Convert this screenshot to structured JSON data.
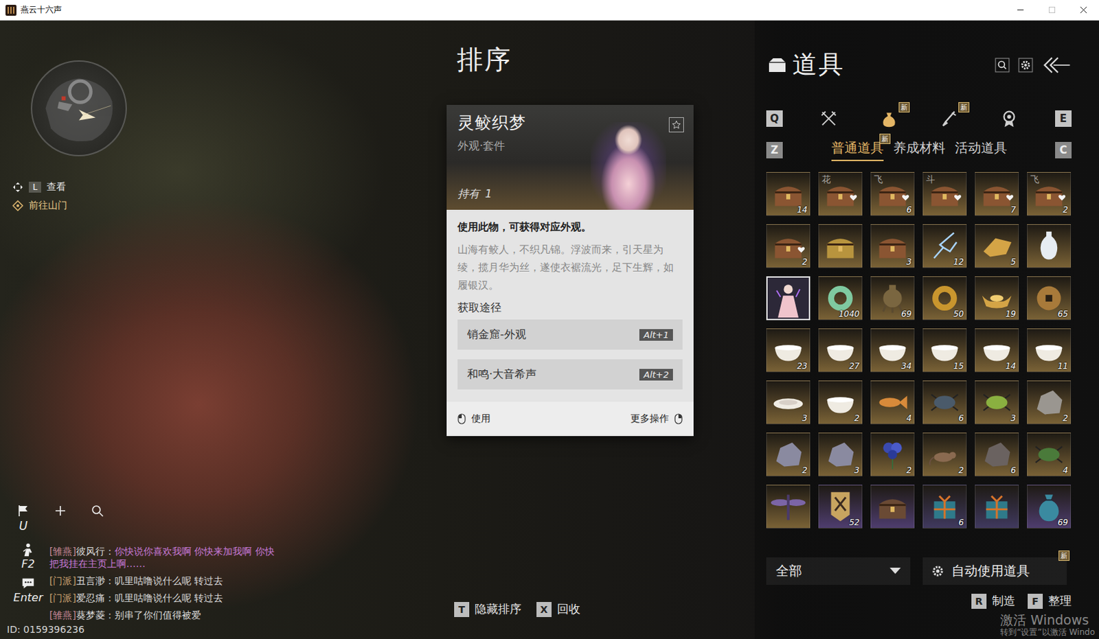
{
  "window": {
    "title": "燕云十六声"
  },
  "hud": {
    "view_hint": {
      "key": "L",
      "label": "查看"
    },
    "quest_hint": {
      "label": "前往山门"
    },
    "quick_buttons": [
      {
        "kind": "flag",
        "key": "U"
      },
      {
        "kind": "plus",
        "key": ""
      },
      {
        "kind": "search",
        "key": ""
      }
    ],
    "chat_buttons": [
      {
        "kind": "figure",
        "key": "F2"
      },
      {
        "kind": "chat",
        "key": "Enter"
      }
    ],
    "player_id": "ID: 0159396236"
  },
  "chat": [
    {
      "channel": "[雏燕]",
      "name": "彼风行：",
      "text": "你快说你喜欢我啊 你快来加我啊 你快把我挂在主页上啊……",
      "color": "#c77ad8",
      "channel_color": "#c98a9a"
    },
    {
      "channel": "[门派]",
      "name": "丑言渺：",
      "text": "叽里咕噜说什么呢 转过去",
      "color": "#dcdcdc",
      "channel_color": "#c8a070"
    },
    {
      "channel": "[门派]",
      "name": "爱忍痛：",
      "text": "叽里咕噜说什么呢 转过去",
      "color": "#dcdcdc",
      "channel_color": "#c8a070"
    },
    {
      "channel": "[雏燕]",
      "name": "葵梦菱：",
      "text": "别串了你们值得被爱",
      "color": "#dcdcdc",
      "channel_color": "#c98a9a"
    }
  ],
  "sort": {
    "title": "排序",
    "actions": [
      {
        "key": "T",
        "label": "隐藏排序"
      },
      {
        "key": "X",
        "label": "回收"
      }
    ]
  },
  "tooltip": {
    "name": "灵鲛织梦",
    "type": "外观·套件",
    "favorited": false,
    "held": {
      "label": "持有",
      "value": "1"
    },
    "description": "使用此物，可获得对应外观。",
    "lore": "山海有鲛人，不织凡锦。浮波而来，引天星为绫，揽月华为丝，遂使衣裾流光，足下生辉，如履银汉。",
    "sources_title": "获取途径",
    "sources": [
      {
        "label": "销金窟-外观",
        "key": "Alt+1"
      },
      {
        "label": "和鸣·大音希声",
        "key": "Alt+2"
      }
    ],
    "actions": [
      {
        "label": "使用",
        "button": "left"
      },
      {
        "label": "更多操作",
        "button": "right"
      }
    ]
  },
  "panel": {
    "title": "道具",
    "tab_keys": {
      "prev": "Q",
      "next": "E"
    },
    "tabs": [
      {
        "kind": "weapon",
        "selected": false,
        "badge": ""
      },
      {
        "kind": "bag",
        "selected": true,
        "badge": "新"
      },
      {
        "kind": "brush",
        "selected": false,
        "badge": "新"
      },
      {
        "kind": "medal",
        "selected": false,
        "badge": ""
      }
    ],
    "subtab_keys": {
      "prev": "Z",
      "next": "C"
    },
    "subtabs": [
      {
        "label": "普通道具",
        "selected": true,
        "badge": "新"
      },
      {
        "label": "养成材料",
        "selected": false,
        "badge": ""
      },
      {
        "label": "活动道具",
        "selected": false,
        "badge": ""
      }
    ],
    "items": [
      {
        "kind": "chest",
        "count": "14",
        "mark": "",
        "liked": false,
        "color": "#7a6236",
        "selected": false
      },
      {
        "kind": "chest",
        "count": "",
        "mark": "花",
        "liked": true,
        "color": "#7a6236",
        "selected": false
      },
      {
        "kind": "chest",
        "count": "6",
        "mark": "飞",
        "liked": true,
        "color": "#7a6236",
        "selected": false
      },
      {
        "kind": "chest",
        "count": "",
        "mark": "斗",
        "liked": true,
        "color": "#7a6236",
        "selected": false
      },
      {
        "kind": "chest",
        "count": "7",
        "mark": "",
        "liked": true,
        "color": "#7a6236",
        "selected": false
      },
      {
        "kind": "chest",
        "count": "2",
        "mark": "飞",
        "liked": true,
        "color": "#7a6236",
        "selected": false
      },
      {
        "kind": "chest",
        "count": "2",
        "mark": "",
        "liked": true,
        "color": "#7a6236",
        "selected": false
      },
      {
        "kind": "casket",
        "count": "",
        "mark": "",
        "liked": false,
        "color": "#7a6236",
        "selected": false
      },
      {
        "kind": "chest",
        "count": "3",
        "mark": "",
        "liked": false,
        "color": "#7a6236",
        "selected": false
      },
      {
        "kind": "spark",
        "count": "12",
        "mark": "",
        "liked": false,
        "color": "#7a6236",
        "selected": false
      },
      {
        "kind": "shard",
        "count": "5",
        "mark": "",
        "liked": false,
        "color": "#7a6236",
        "selected": false
      },
      {
        "kind": "vase",
        "count": "",
        "mark": "",
        "liked": false,
        "color": "#7a6236",
        "selected": false
      },
      {
        "kind": "portrait",
        "count": "",
        "mark": "",
        "liked": false,
        "color": "#7a6236",
        "selected": true
      },
      {
        "kind": "jade-ring",
        "count": "1040",
        "mark": "",
        "liked": false,
        "color": "#7a6236",
        "selected": false
      },
      {
        "kind": "censer",
        "count": "69",
        "mark": "",
        "liked": false,
        "color": "#7a6236",
        "selected": false
      },
      {
        "kind": "gold-ring",
        "count": "50",
        "mark": "",
        "liked": false,
        "color": "#7a6236",
        "selected": false
      },
      {
        "kind": "ingot",
        "count": "19",
        "mark": "",
        "liked": false,
        "color": "#7a6236",
        "selected": false
      },
      {
        "kind": "coin",
        "count": "65",
        "mark": "",
        "liked": false,
        "color": "#7a6236",
        "selected": false
      },
      {
        "kind": "bowl",
        "count": "23",
        "mark": "",
        "liked": false,
        "color": "#7a6236",
        "selected": false
      },
      {
        "kind": "bowl",
        "count": "27",
        "mark": "",
        "liked": false,
        "color": "#7a6236",
        "selected": false
      },
      {
        "kind": "bowl",
        "count": "34",
        "mark": "",
        "liked": false,
        "color": "#7a6236",
        "selected": false
      },
      {
        "kind": "bowl",
        "count": "15",
        "mark": "",
        "liked": false,
        "color": "#7a6236",
        "selected": false
      },
      {
        "kind": "bowl",
        "count": "14",
        "mark": "",
        "liked": false,
        "color": "#7a6236",
        "selected": false
      },
      {
        "kind": "lidded-bowl",
        "count": "11",
        "mark": "",
        "liked": false,
        "color": "#7a6236",
        "selected": false
      },
      {
        "kind": "dish",
        "count": "3",
        "mark": "",
        "liked": false,
        "color": "#7a6236",
        "selected": false
      },
      {
        "kind": "bowl",
        "count": "2",
        "mark": "",
        "liked": false,
        "color": "#7a6236",
        "selected": false
      },
      {
        "kind": "fish",
        "count": "4",
        "mark": "",
        "liked": false,
        "color": "#7a6236",
        "selected": false
      },
      {
        "kind": "beetle",
        "count": "6",
        "mark": "",
        "liked": false,
        "color": "#7a6236",
        "selected": false
      },
      {
        "kind": "cricket",
        "count": "3",
        "mark": "",
        "liked": false,
        "color": "#7a6236",
        "selected": false
      },
      {
        "kind": "rock",
        "count": "2",
        "mark": "",
        "liked": false,
        "color": "#7a6236",
        "selected": false
      },
      {
        "kind": "ore",
        "count": "2",
        "mark": "",
        "liked": false,
        "color": "#7a6236",
        "selected": false
      },
      {
        "kind": "ore",
        "count": "3",
        "mark": "",
        "liked": false,
        "color": "#7a6236",
        "selected": false
      },
      {
        "kind": "flower",
        "count": "2",
        "mark": "",
        "liked": false,
        "color": "#7a6236",
        "selected": false
      },
      {
        "kind": "rat",
        "count": "2",
        "mark": "",
        "liked": false,
        "color": "#7a6236",
        "selected": false
      },
      {
        "kind": "stone",
        "count": "6",
        "mark": "",
        "liked": false,
        "color": "#7a6236",
        "selected": false
      },
      {
        "kind": "grasshopper",
        "count": "4",
        "mark": "",
        "liked": false,
        "color": "#7a6236",
        "selected": false
      },
      {
        "kind": "dragonfly",
        "count": "",
        "mark": "",
        "liked": false,
        "color": "#7a6236",
        "selected": false
      },
      {
        "kind": "banner",
        "count": "52",
        "mark": "",
        "liked": false,
        "color": "#4e3d6e",
        "selected": false
      },
      {
        "kind": "crate",
        "count": "",
        "mark": "",
        "liked": false,
        "color": "#4e3d6e",
        "selected": false
      },
      {
        "kind": "gift",
        "count": "6",
        "mark": "",
        "liked": false,
        "color": "#40395e",
        "selected": false
      },
      {
        "kind": "gift",
        "count": "",
        "mark": "",
        "liked": false,
        "color": "#40395e",
        "selected": false
      },
      {
        "kind": "pouch",
        "count": "69",
        "mark": "",
        "liked": false,
        "color": "#4e3d6e",
        "selected": false
      }
    ],
    "filter": {
      "value": "全部"
    },
    "auto_use": {
      "label": "自动使用道具",
      "badge": "新"
    },
    "actions": [
      {
        "key": "R",
        "label": "制造"
      },
      {
        "key": "F",
        "label": "整理"
      }
    ]
  },
  "watermark": {
    "title": "激活 Windows",
    "subtitle": "转到“设置”以激活 Windo"
  }
}
